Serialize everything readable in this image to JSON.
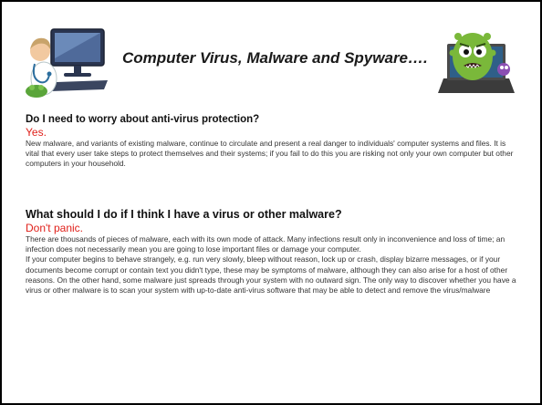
{
  "header": {
    "title": "Computer Virus, Malware and Spyware….",
    "left_image": "computer-doctor-image",
    "right_image": "virus-monster-laptop-image"
  },
  "sections": [
    {
      "question": "Do I need to worry about anti-virus protection?",
      "answer": "Yes.",
      "paragraphs": [
        "New malware, and variants of existing malware, continue to circulate and present a real danger to individuals' computer systems and files. It is vital that every user take steps to protect themselves and their systems; if you fail to do this you are risking not only your own computer but other computers in your household."
      ]
    },
    {
      "question": "What should I do if I think I have a virus or other malware?",
      "answer": "Don't panic.",
      "paragraphs": [
        "There are thousands of pieces of malware, each with its own mode of attack. Many infections result only in inconvenience and loss of time; an infection does not necessarily mean you are going to lose important files or damage your computer.",
        "If your computer begins to behave strangely, e.g. run very slowly, bleep without reason, lock up or crash, display bizarre messages, or if your documents become corrupt or contain text you didn't type, these may be symptoms of malware, although they can also arise for a host of other reasons. On the other hand, some malware just spreads through your system with no outward sign. The only way to discover whether you have a virus or other malware is to scan your system with up-to-date anti-virus software that may be able to detect and remove the virus/malware"
      ]
    }
  ],
  "colors": {
    "answer": "#e0211b",
    "border": "#000000"
  }
}
